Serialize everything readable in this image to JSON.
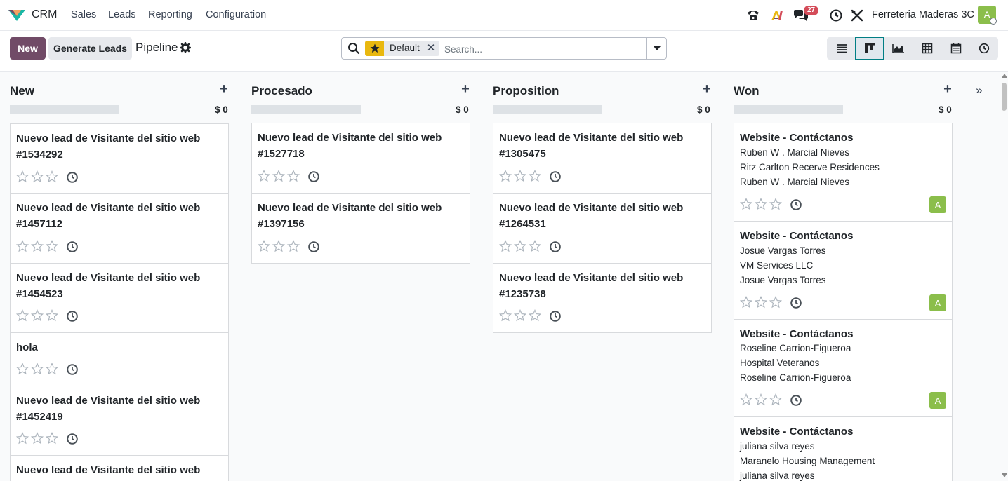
{
  "app": {
    "name": "CRM"
  },
  "menu": [
    "Sales",
    "Leads",
    "Reporting",
    "Configuration"
  ],
  "systray": {
    "messages_count": "27",
    "company": "Ferreteria Maderas 3C",
    "avatar_initial": "A"
  },
  "control": {
    "new_label": "New",
    "generate_label": "Generate Leads",
    "breadcrumb": "Pipeline",
    "facet_value": "Default",
    "facet_remove": "✕",
    "search_placeholder": "Search..."
  },
  "views": [
    "list-view",
    "kanban-view",
    "graph-view",
    "pivot-view",
    "calendar-view",
    "activity-view"
  ],
  "active_view": "kanban-view",
  "fold_label": "»",
  "columns": [
    {
      "title": "New",
      "add": "+",
      "total": "$ 0",
      "cards": [
        {
          "title": "Nuevo lead de Visitante del sitio web #1534292",
          "lines": []
        },
        {
          "title": "Nuevo lead de Visitante del sitio web #1457112",
          "lines": []
        },
        {
          "title": "Nuevo lead de Visitante del sitio web #1454523",
          "lines": []
        },
        {
          "title": "hola",
          "lines": []
        },
        {
          "title": "Nuevo lead de Visitante del sitio web #1452419",
          "lines": []
        },
        {
          "title": "Nuevo lead de Visitante del sitio web",
          "lines": []
        }
      ]
    },
    {
      "title": "Procesado",
      "add": "+",
      "total": "$ 0",
      "cards": [
        {
          "title": "Nuevo lead de Visitante del sitio web #1527718",
          "lines": []
        },
        {
          "title": "Nuevo lead de Visitante del sitio web #1397156",
          "lines": []
        }
      ]
    },
    {
      "title": "Proposition",
      "add": "+",
      "total": "$ 0",
      "cards": [
        {
          "title": "Nuevo lead de Visitante del sitio web #1305475",
          "lines": []
        },
        {
          "title": "Nuevo lead de Visitante del sitio web #1264531",
          "lines": []
        },
        {
          "title": "Nuevo lead de Visitante del sitio web #1235738",
          "lines": []
        }
      ]
    },
    {
      "title": "Won",
      "add": "+",
      "total": "$ 0",
      "cards": [
        {
          "title": "Website - Contáctanos",
          "lines": [
            "Ruben W . Marcial Nieves",
            "Ritz Carlton Recerve Residences",
            "Ruben W . Marcial Nieves"
          ],
          "avatar": "A"
        },
        {
          "title": "Website - Contáctanos",
          "lines": [
            "Josue Vargas Torres",
            "VM Services LLC",
            "Josue Vargas Torres"
          ],
          "avatar": "A"
        },
        {
          "title": "Website - Contáctanos",
          "lines": [
            "Roseline Carrion-Figueroa",
            "Hospital Veteranos",
            "Roseline Carrion-Figueroa"
          ],
          "avatar": "A"
        },
        {
          "title": "Website - Contáctanos",
          "lines": [
            "juliana silva reyes",
            "Maranelo Housing Management",
            "juliana silva reyes"
          ]
        }
      ]
    }
  ],
  "colors": {
    "primary": "#714b67",
    "facet": "#e9b80f",
    "avatar": "#8bbe4b",
    "badge": "#d44c59",
    "active_view_border": "#017e84"
  }
}
